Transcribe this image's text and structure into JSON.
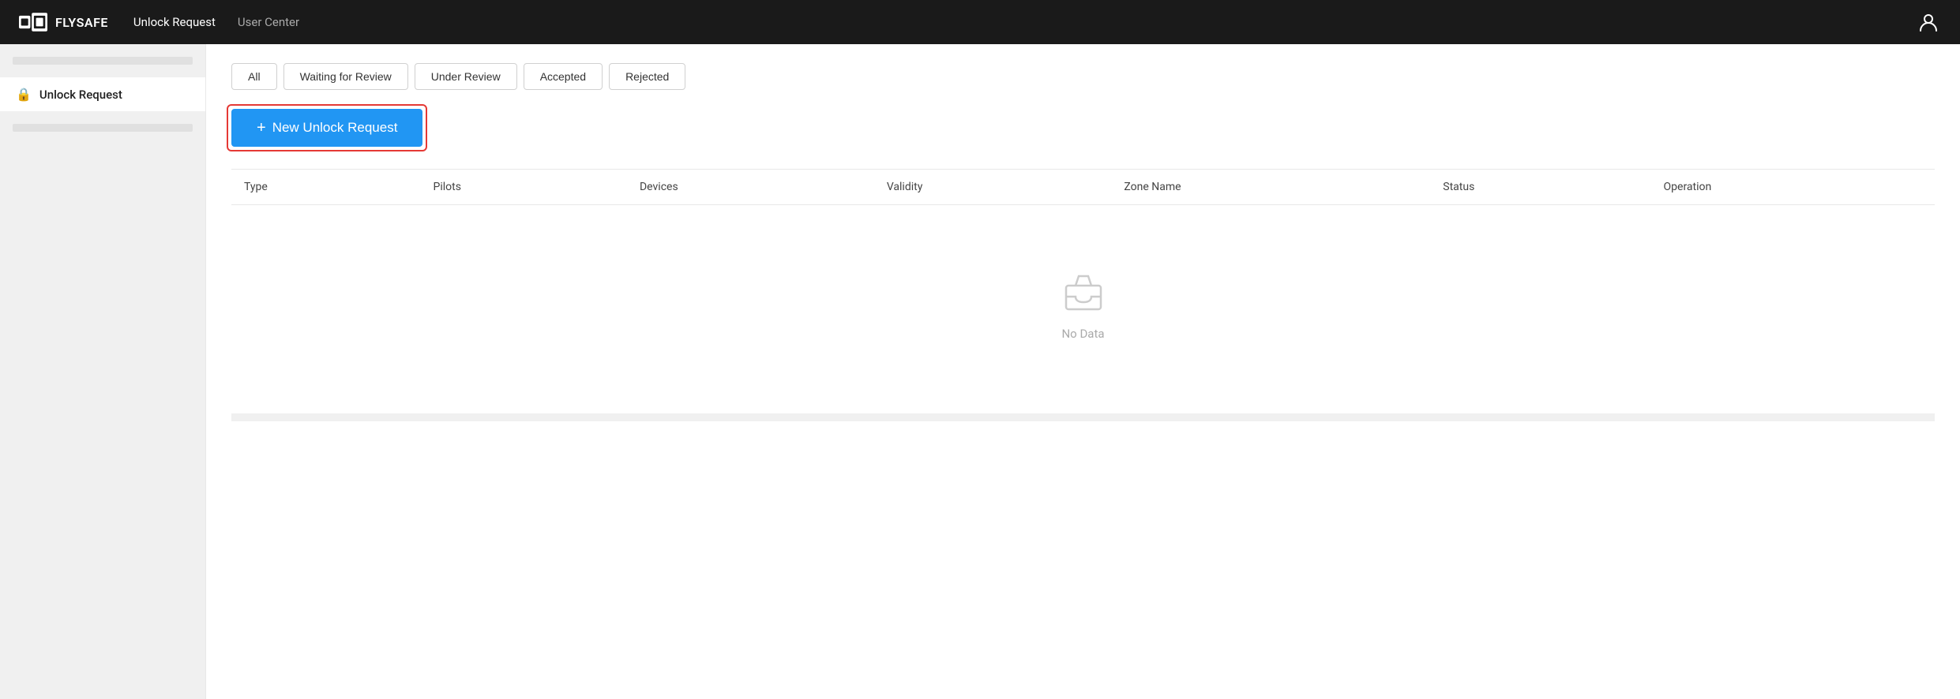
{
  "navbar": {
    "brand": "FLYSAFE",
    "nav_primary": "Unlock Request",
    "nav_secondary": "User Center",
    "user_icon": "person"
  },
  "sidebar": {
    "item_label": "Unlock Request",
    "item_icon": "lock"
  },
  "filters": {
    "tabs": [
      {
        "label": "All",
        "key": "all"
      },
      {
        "label": "Waiting for Review",
        "key": "waiting"
      },
      {
        "label": "Under Review",
        "key": "under"
      },
      {
        "label": "Accepted",
        "key": "accepted"
      },
      {
        "label": "Rejected",
        "key": "rejected"
      }
    ]
  },
  "new_request_button": {
    "label": "New Unlock Request",
    "plus": "+"
  },
  "table": {
    "columns": [
      {
        "label": "Type",
        "key": "type"
      },
      {
        "label": "Pilots",
        "key": "pilots"
      },
      {
        "label": "Devices",
        "key": "devices"
      },
      {
        "label": "Validity",
        "key": "validity"
      },
      {
        "label": "Zone Name",
        "key": "zone_name"
      },
      {
        "label": "Status",
        "key": "status"
      },
      {
        "label": "Operation",
        "key": "operation"
      }
    ],
    "empty_text": "No Data"
  }
}
